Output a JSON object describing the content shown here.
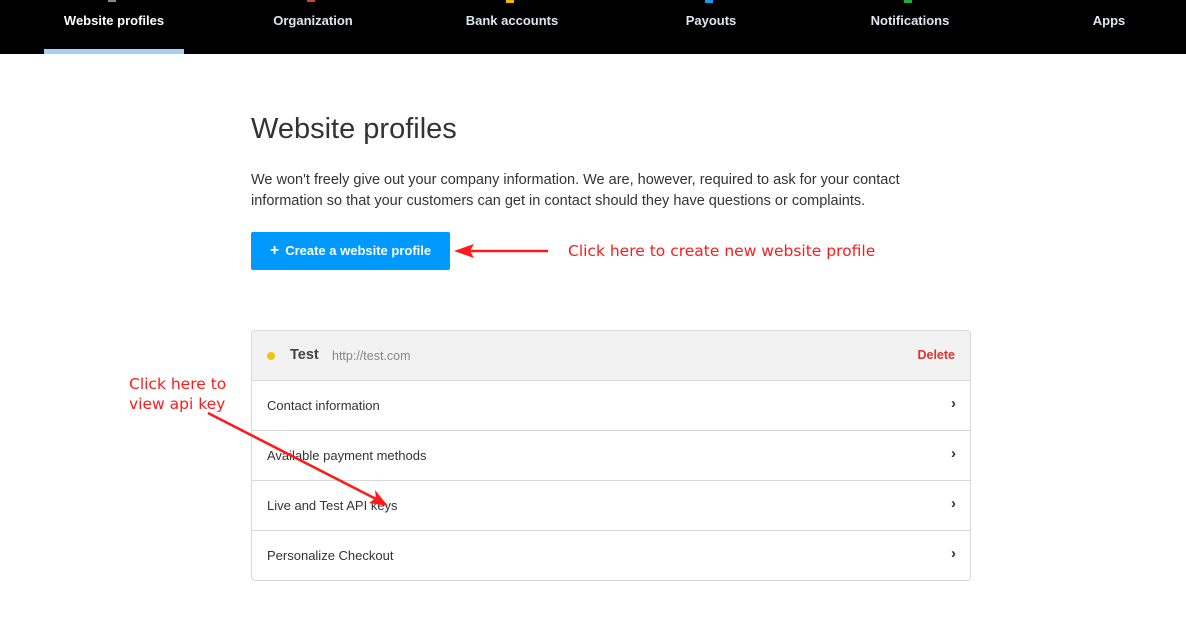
{
  "nav": {
    "tabs": [
      {
        "label": "Website profiles",
        "active": true,
        "icon_color": "#888888"
      },
      {
        "label": "Organization",
        "active": false,
        "icon_color": "#c0502a"
      },
      {
        "label": "Bank accounts",
        "active": false,
        "icon_color": "#f5b800"
      },
      {
        "label": "Payouts",
        "active": false,
        "icon_color": "#1a9be8"
      },
      {
        "label": "Notifications",
        "active": false,
        "icon_color": "#1fae3a"
      },
      {
        "label": "Apps",
        "active": false,
        "icon_color": "#000000"
      }
    ]
  },
  "main": {
    "title": "Website profiles",
    "intro": "We won't freely give out your company information. We are, however, required to ask for your contact information so that your customers can get in contact should they have questions or complaints.",
    "create_button": {
      "icon": "plus-icon",
      "label": "Create a website profile",
      "plus": "+"
    }
  },
  "profile": {
    "name": "Test",
    "url": "http://test.com",
    "status_color": "#f5c211",
    "delete_label": "Delete",
    "rows": [
      {
        "label": "Contact information"
      },
      {
        "label": "Available payment methods"
      },
      {
        "label": "Live and Test API keys"
      },
      {
        "label": "Personalize Checkout"
      }
    ],
    "chevron": "›"
  },
  "annotations": {
    "create_note": "Click here to create new website profile",
    "api_note_line1": "Click here to",
    "api_note_line2": "view api key",
    "color": "#ff1a1a"
  }
}
